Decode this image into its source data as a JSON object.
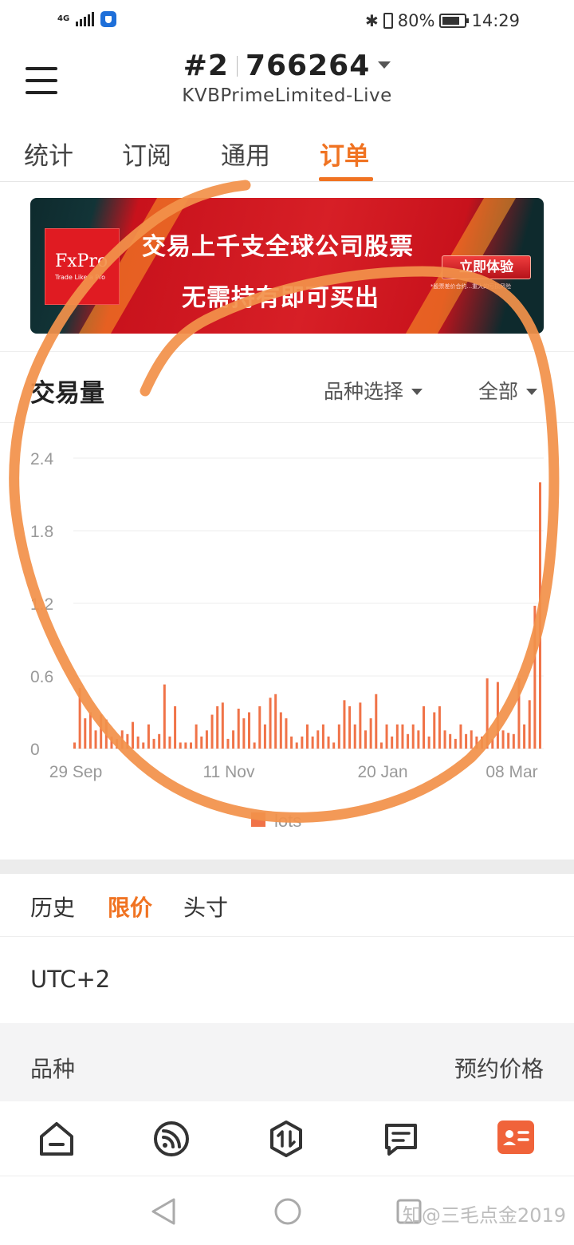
{
  "status_bar": {
    "network": "4G",
    "battery": "80%",
    "time": "14:29"
  },
  "header": {
    "account_prefix": "#2",
    "account_number": "766264",
    "broker": "KVBPrimeLimited-Live"
  },
  "tabs": [
    {
      "label": "统计",
      "active": false
    },
    {
      "label": "订阅",
      "active": false
    },
    {
      "label": "通用",
      "active": false
    },
    {
      "label": "订单",
      "active": true
    }
  ],
  "banner": {
    "logo_name": "FxPro",
    "logo_tagline": "Trade Like a Pro",
    "line1": "交易上千支全球公司股票",
    "line2": "无需持有即可买出",
    "cta": "立即体验",
    "disclaimer": "*股票差价合约...重大的亏损风险"
  },
  "volume_section": {
    "title": "交易量",
    "symbol_dropdown": "品种选择",
    "range_dropdown": "全部"
  },
  "chart_data": {
    "type": "bar",
    "title": "",
    "ylim": [
      0,
      2.4
    ],
    "y_ticks": [
      "0",
      "0.6",
      "1.2",
      "1.8",
      "2.4"
    ],
    "x_tick_labels": [
      "29 Sep",
      "11 Nov",
      "20 Jan",
      "08 Mar"
    ],
    "legend": "lots",
    "series_color": "#f07348",
    "values": [
      0.05,
      0.5,
      0.25,
      0.3,
      0.15,
      0.28,
      0.24,
      0.1,
      0.08,
      0.15,
      0.12,
      0.22,
      0.1,
      0.05,
      0.2,
      0.08,
      0.12,
      0.53,
      0.1,
      0.35,
      0.05,
      0.05,
      0.05,
      0.2,
      0.1,
      0.15,
      0.28,
      0.35,
      0.38,
      0.08,
      0.15,
      0.33,
      0.25,
      0.3,
      0.05,
      0.35,
      0.2,
      0.42,
      0.45,
      0.3,
      0.25,
      0.1,
      0.05,
      0.1,
      0.2,
      0.1,
      0.15,
      0.2,
      0.1,
      0.05,
      0.2,
      0.4,
      0.35,
      0.2,
      0.38,
      0.15,
      0.25,
      0.45,
      0.05,
      0.2,
      0.1,
      0.2,
      0.2,
      0.12,
      0.2,
      0.15,
      0.35,
      0.1,
      0.3,
      0.35,
      0.15,
      0.12,
      0.08,
      0.2,
      0.12,
      0.15,
      0.1,
      0.1,
      0.58,
      0.08,
      0.55,
      0.15,
      0.13,
      0.12,
      0.58,
      0.2,
      0.4,
      1.18,
      2.2
    ]
  },
  "subtabs": [
    {
      "label": "历史",
      "active": false
    },
    {
      "label": "限价",
      "active": true
    },
    {
      "label": "头寸",
      "active": false
    }
  ],
  "timezone": "UTC+2",
  "table_header": {
    "left": "品种",
    "right": "预约价格"
  },
  "bottom_nav": [
    {
      "icon": "home-icon",
      "active": false
    },
    {
      "icon": "feed-icon",
      "active": false
    },
    {
      "icon": "trade-icon",
      "active": false
    },
    {
      "icon": "message-icon",
      "active": false
    },
    {
      "icon": "profile-icon",
      "active": true
    }
  ],
  "watermark": "知@三毛点金2019",
  "colors": {
    "accent": "#f07322",
    "bar": "#f07348",
    "annotation": "#f2914a"
  }
}
